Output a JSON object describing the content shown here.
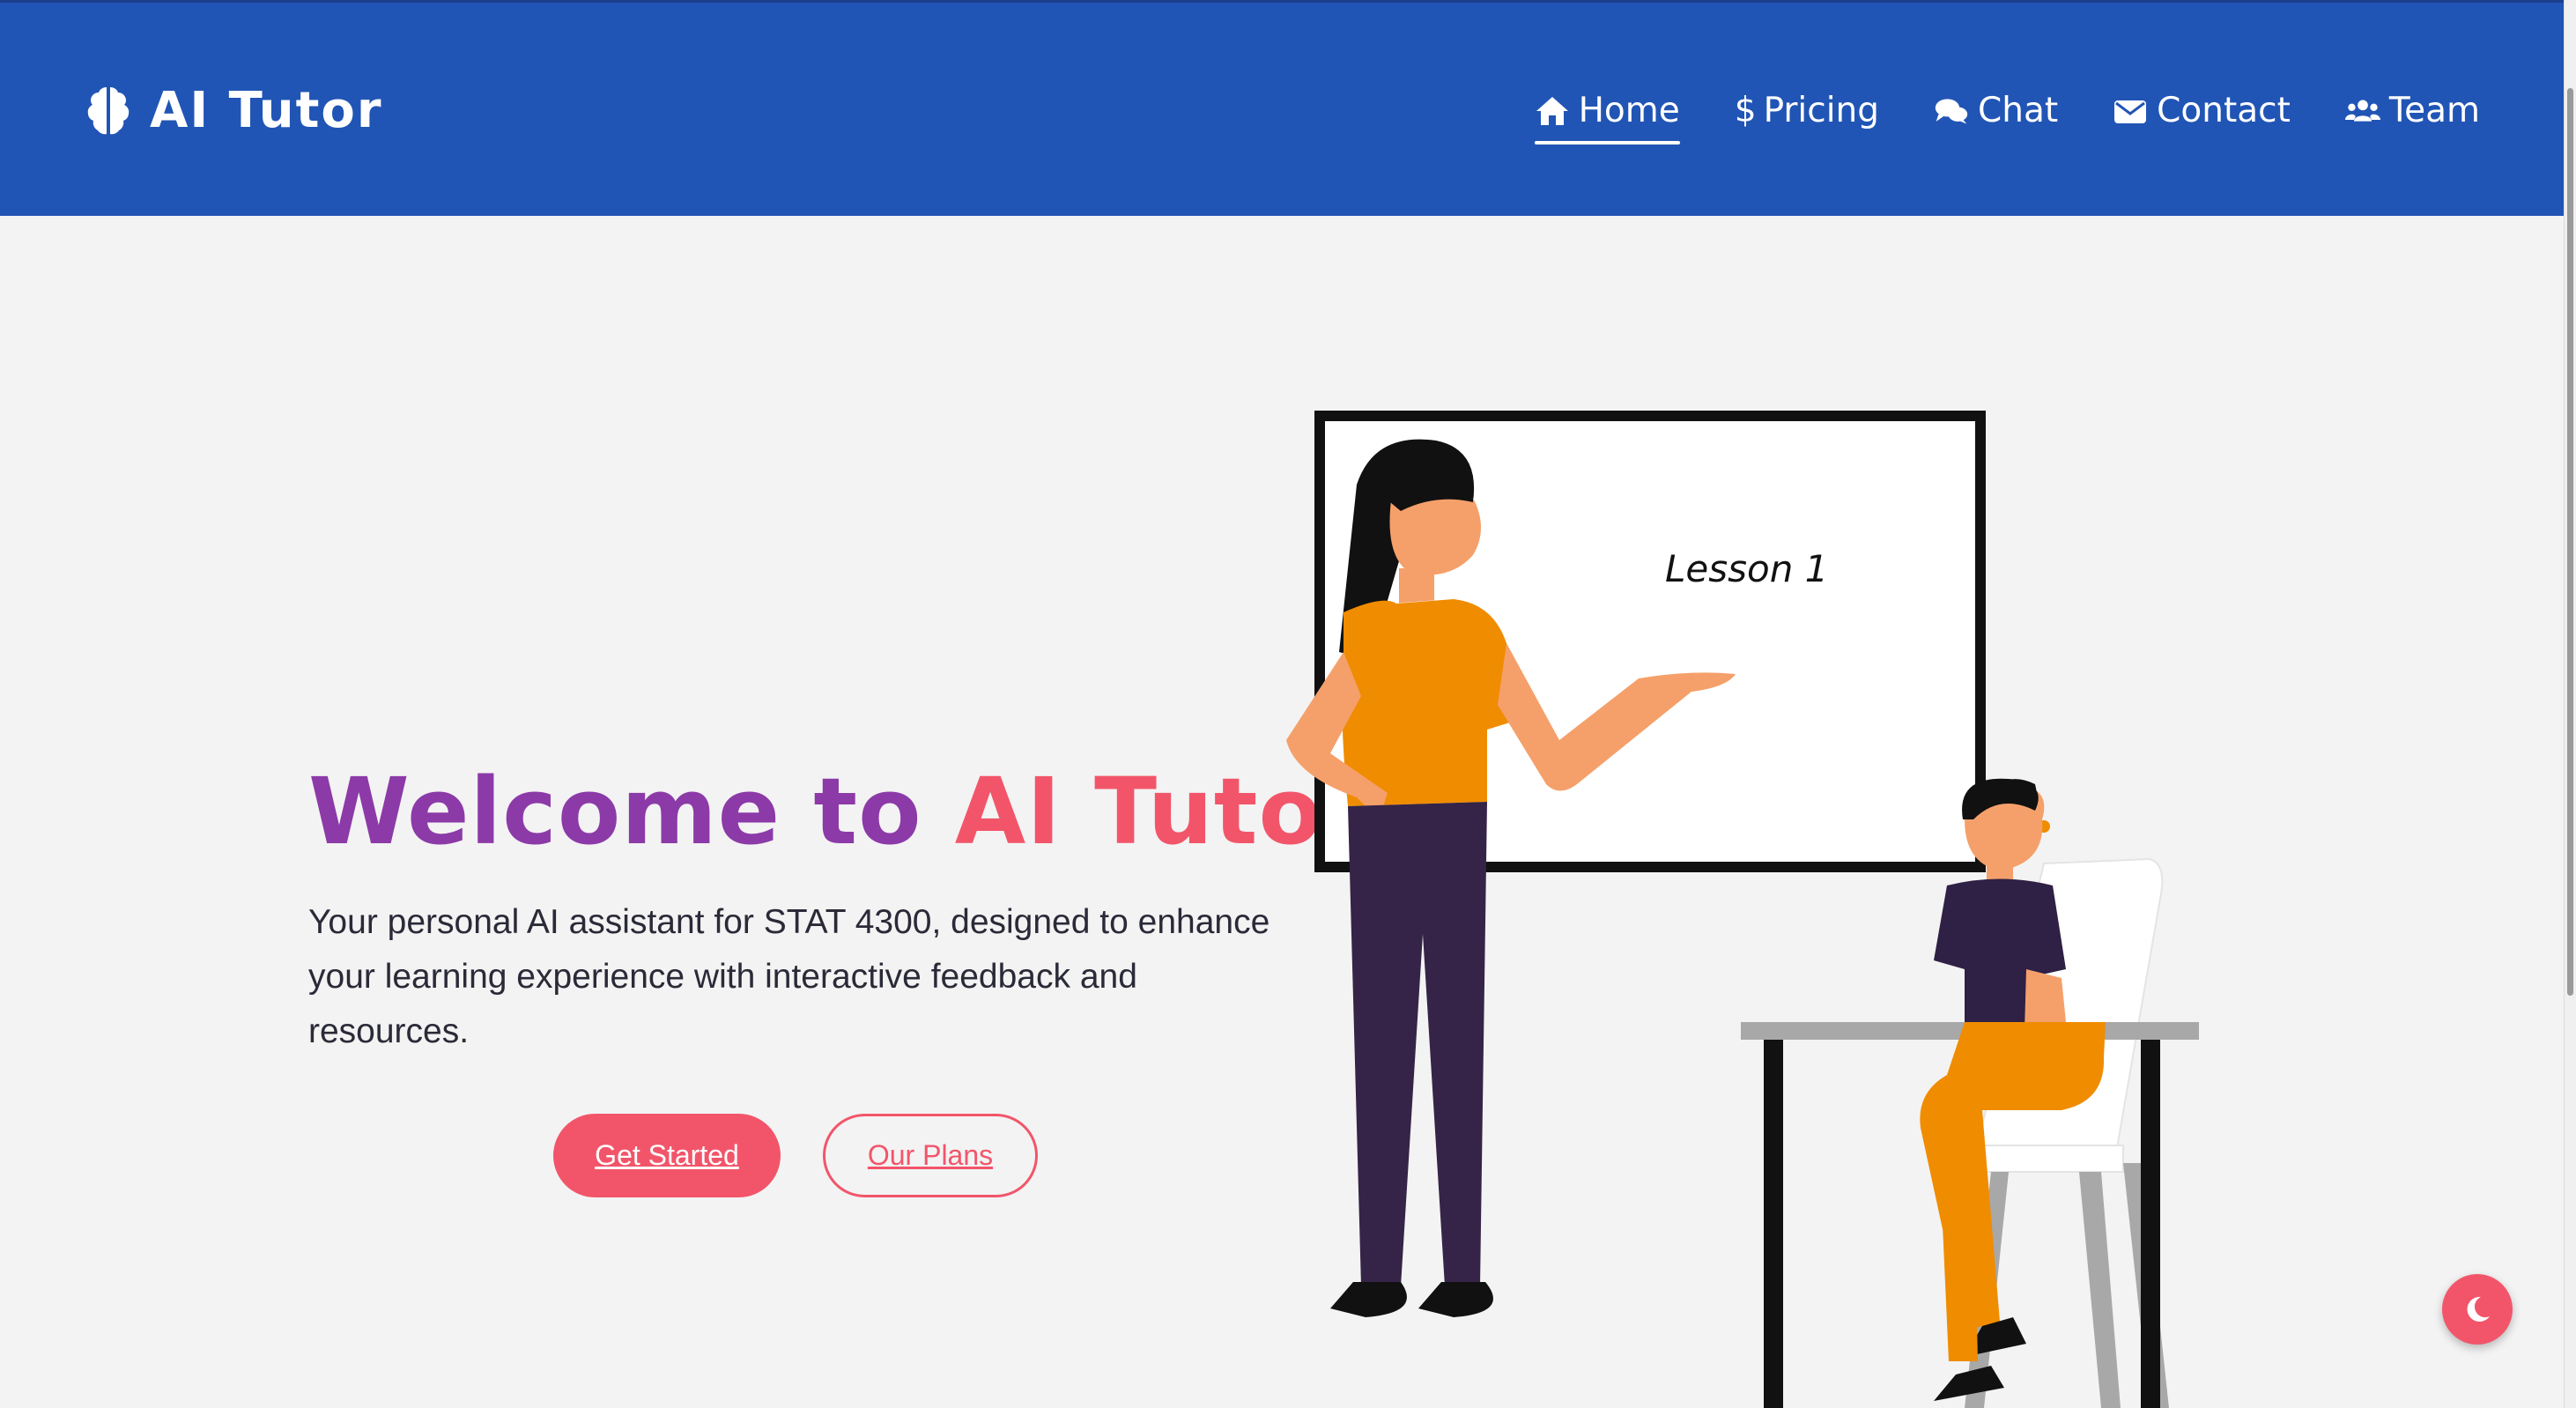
{
  "header": {
    "logo_text": "AI Tutor",
    "nav": [
      {
        "label": "Home",
        "icon": "home-icon",
        "active": true
      },
      {
        "label": "Pricing",
        "icon": "dollar-icon",
        "active": false
      },
      {
        "label": "Chat",
        "icon": "chat-icon",
        "active": false
      },
      {
        "label": "Contact",
        "icon": "envelope-icon",
        "active": false
      },
      {
        "label": "Team",
        "icon": "users-icon",
        "active": false
      }
    ],
    "pricing_symbol": "$"
  },
  "hero": {
    "title_part1": "Welcome to",
    "title_part2": "AI Tutor",
    "description": "Your personal AI assistant for STAT 4300, designed to enhance your learning experience with interactive feedback and resources.",
    "primary_button": "Get Started",
    "secondary_button": "Our Plans"
  },
  "illustration": {
    "board_text": "Lesson 1"
  },
  "colors": {
    "header_bg": "#2155b5",
    "title_purple": "#8c3aa8",
    "accent_pink": "#f2556a",
    "page_bg": "#f3f3f3"
  },
  "theme_toggle": {
    "icon": "moon-icon"
  }
}
